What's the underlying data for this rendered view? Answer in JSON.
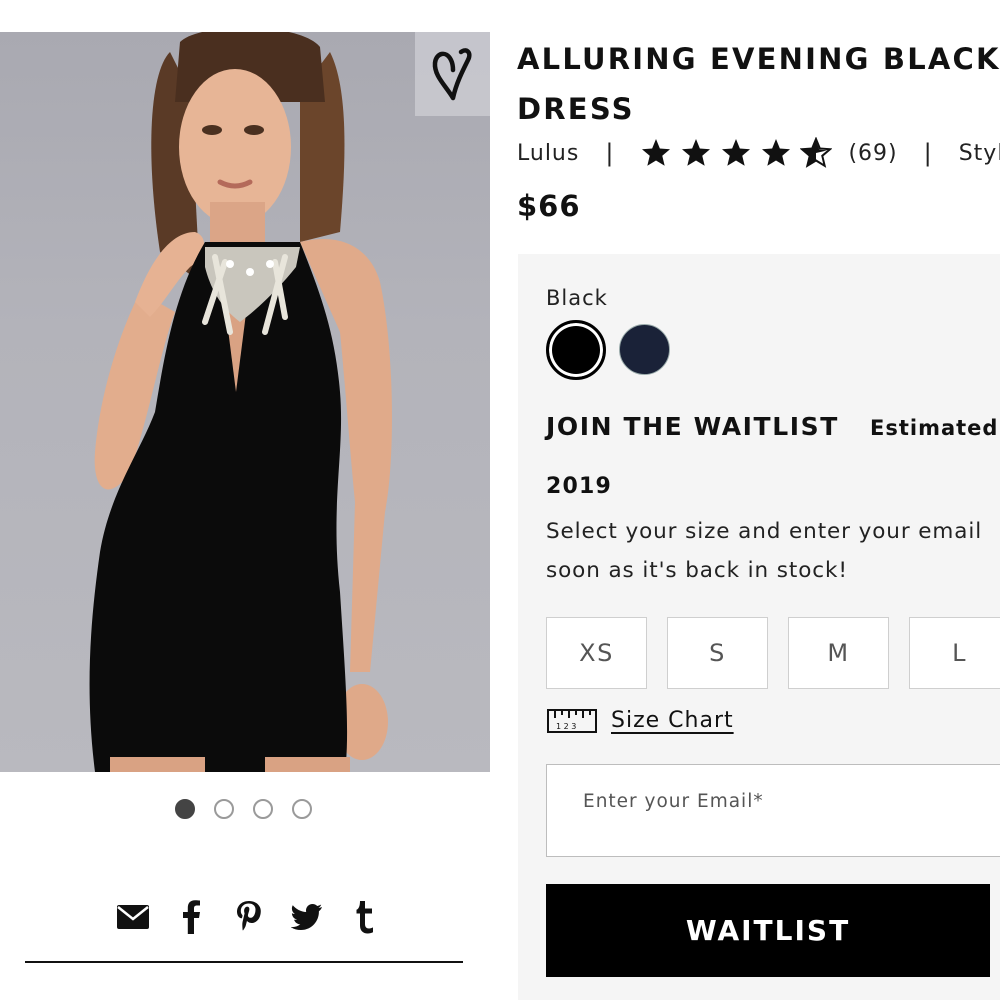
{
  "product": {
    "title_line1": "ALLURING EVENING BLACK",
    "title_line2": "DRESS",
    "brand": "Lulus",
    "rating": 4.5,
    "rating_max": 5,
    "reviews_count": "(69)",
    "style_label": "Style",
    "price": "$66",
    "image_alt": "Woman wearing black halter bodycon dress with embellished neckline"
  },
  "gallery": {
    "slide_count": 4,
    "active_index": 0
  },
  "colors": {
    "selected_label": "Black",
    "swatches": [
      {
        "name": "Black",
        "hex": "#000000",
        "selected": true
      },
      {
        "name": "Navy",
        "hex": "#1a2238",
        "selected": false
      }
    ]
  },
  "waitlist": {
    "heading": "JOIN THE WAITLIST",
    "estimated_label": "Estimated",
    "year": "2019",
    "description_line1": "Select your size and enter your email",
    "description_line2": "soon as it's back in stock!"
  },
  "sizes": [
    "XS",
    "S",
    "M",
    "L"
  ],
  "size_chart_label": "Size Chart",
  "email_placeholder": "Enter your Email*",
  "waitlist_button": "WAITLIST",
  "share_icons": [
    "mail-icon",
    "facebook-icon",
    "pinterest-icon",
    "twitter-icon",
    "tumblr-icon"
  ],
  "theme": {
    "panel_bg": "#f5f5f5",
    "button_bg": "#000000",
    "button_text": "#ffffff"
  }
}
